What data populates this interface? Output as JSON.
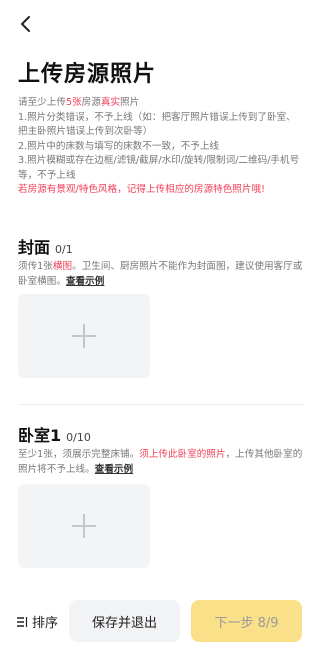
{
  "header": {
    "back_icon": "chevron-left-icon",
    "title": "上传房源照片"
  },
  "intro": {
    "l1_a": "请至少上传",
    "l1_b": "5张",
    "l1_c": "房源",
    "l1_d": "真实",
    "l1_e": "照片",
    "l2": "1.照片分类错误，不予上线（如：把客厅照片错误上传到了卧室、把主卧照片错误上传到次卧等）",
    "l3": "2.照片中的床数与填写的床数不一致，不予上线",
    "l4": "3.照片模糊或存在边框/滤镜/截屏/水印/旋转/限制词/二维码/手机号等，不予上线",
    "l5": "若房源有景观/特色风格，记得上传相应的房源特色照片哦!"
  },
  "cover": {
    "title": "封面",
    "count": "0/1",
    "desc_a": "须传1张",
    "desc_b": "横图",
    "desc_c": "。卫生间、厨房照片不能作为封面图，建议使用客厅或卧室横图。",
    "link": "查看示例"
  },
  "bedroom": {
    "title": "卧室1",
    "count": "0/10",
    "desc_a": "至少1张，须展示完整床铺。",
    "desc_b": "须上传此卧室的照片",
    "desc_c": "，上传其他卧室的照片将不予上线。",
    "link": "查看示例"
  },
  "bottom": {
    "sort_icon": "sort-icon",
    "sort_label": "排序",
    "save_label": "保存并退出",
    "next_label": "下一步 8/9"
  },
  "colors": {
    "accent_red": "#f0405a",
    "next_bg": "#fbe08a",
    "upload_bg": "#f3f4f6"
  }
}
